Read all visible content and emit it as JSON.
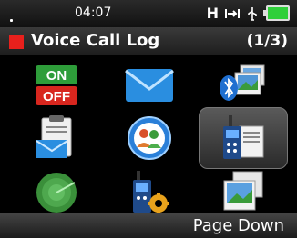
{
  "status": {
    "time": "04:07",
    "signal_mode": "H"
  },
  "title": {
    "text": "Voice Call Log",
    "page": "(1/3)"
  },
  "menu_icons": [
    {
      "name": "on-off-icon",
      "on_label": "ON",
      "off_label": "OFF"
    },
    {
      "name": "mail-icon"
    },
    {
      "name": "bluetooth-picture-icon"
    },
    {
      "name": "clipboard-mail-icon"
    },
    {
      "name": "contacts-group-icon"
    },
    {
      "name": "radio-document-icon",
      "selected": true
    },
    {
      "name": "radar-icon"
    },
    {
      "name": "radio-settings-icon"
    },
    {
      "name": "picture-gallery-icon"
    }
  ],
  "softkeys": {
    "right": "Page Down"
  },
  "colors": {
    "accent_red": "#e8201c",
    "battery_green": "#2fcf3a"
  }
}
